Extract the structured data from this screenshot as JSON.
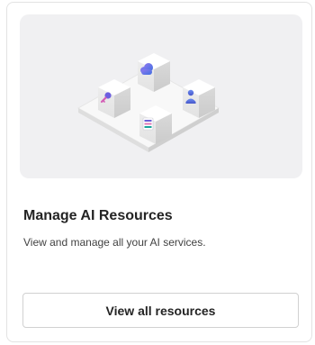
{
  "card": {
    "title": "Manage AI Resources",
    "description": "View and manage all your AI services.",
    "button_label": "View all resources"
  },
  "illustration": {
    "tiles": [
      {
        "icon": "cloud-icon",
        "accent": "#6a64e6"
      },
      {
        "icon": "person-icon",
        "accent": "#4c63d6"
      },
      {
        "icon": "key-icon",
        "accent": "#5d5fe0"
      },
      {
        "icon": "dashboard-icon",
        "accent": "#1aa39a"
      }
    ]
  },
  "colors": {
    "hero_background": "#f0f0f2",
    "button_border": "#d1d1d1"
  }
}
